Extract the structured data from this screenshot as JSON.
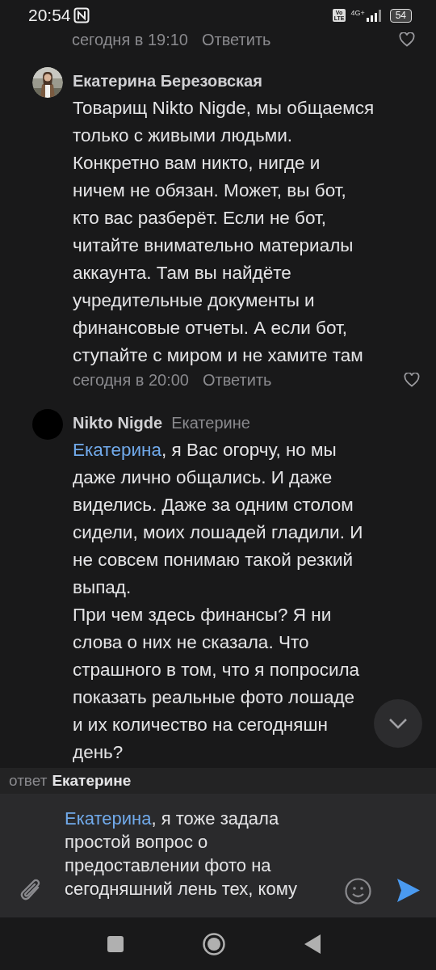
{
  "status_bar": {
    "time": "20:54",
    "volte": "Vo\nLTE",
    "network": "4G+",
    "battery": "54"
  },
  "previous_comment_meta": {
    "date": "сегодня в 19:10",
    "reply": "Ответить"
  },
  "comments": [
    {
      "author": "Екатерина Березовская",
      "lines": [
        "Товарищ Nikto Nigde, мы общаемся",
        "только с живыми людьми.",
        "Конкретно вам никто, нигде и",
        "ничем не обязан. Может, вы бот,",
        "кто вас разберёт. Если не бот,",
        "читайте внимательно материалы",
        "аккаунта. Там вы найдёте",
        "учредительные документы и",
        "финансовые отчеты. А если бот,",
        "ступайте с миром и не хамите там"
      ],
      "date": "сегодня в 20:00",
      "reply": "Ответить"
    },
    {
      "author": "Nikto Nigde",
      "reply_to": "Екатерине",
      "avatar": {
        "kind": "blank"
      },
      "mention": "Екатерина",
      "lines": [
        ", я Вас огорчу, но мы",
        "даже лично общались. И даже",
        "виделись. Даже за одним столом",
        "сидели, моих лошадей гладили. И",
        "не совсем понимаю такой резкий",
        "выпад.",
        "При чем здесь финансы? Я ни",
        "слова о них не сказала. Что",
        "страшного в том, что я попросила",
        "показать реальные фото лошаде",
        "и их количество на сегодняшн",
        "день?"
      ]
    }
  ],
  "reply_bar": {
    "label": "ответ",
    "name": "Екатерине"
  },
  "composer": {
    "mention": "Екатерина",
    "lines": [
      ", я тоже задала",
      "простой вопрос о",
      "предоставлении фото на",
      "сегодняшний лень тех, кому"
    ]
  }
}
